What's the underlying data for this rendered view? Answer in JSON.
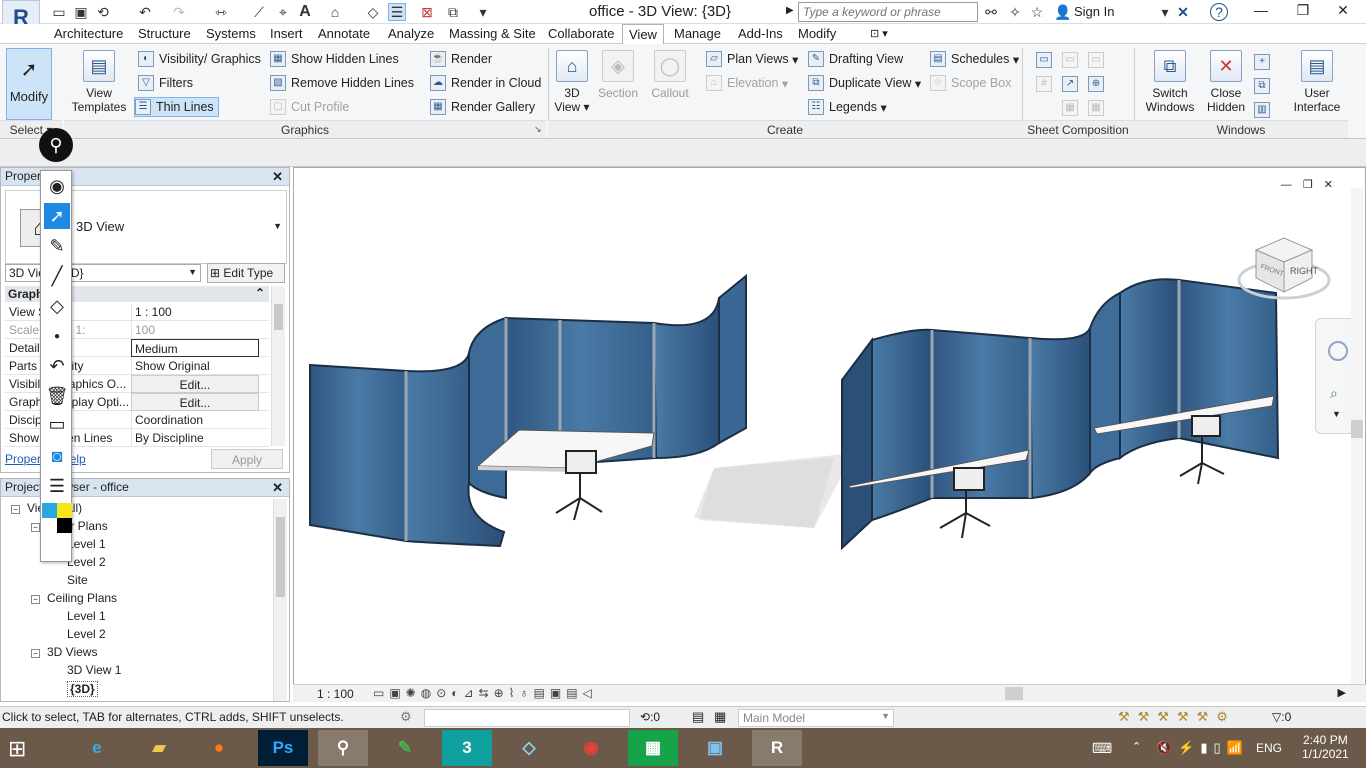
{
  "app": {
    "logo_letter": "R",
    "title": "office - 3D View: {3D}",
    "search_placeholder": "Type a keyword or phrase",
    "sign_in": "Sign In"
  },
  "ribbon_tabs": [
    "Architecture",
    "Structure",
    "Systems",
    "Insert",
    "Annotate",
    "Analyze",
    "Massing & Site",
    "Collaborate",
    "View",
    "Manage",
    "Add-Ins",
    "Modify"
  ],
  "active_tab": "View",
  "ribbon": {
    "modify": "Modify",
    "select": "Select",
    "view_templates": "View Templates",
    "visibility_graphics": "Visibility/ Graphics",
    "filters": "Filters",
    "thin_lines": "Thin Lines",
    "show_hidden_lines": "Show  Hidden Lines",
    "remove_hidden_lines": "Remove  Hidden Lines",
    "cut_profile": "Cut  Profile",
    "render": "Render",
    "render_in_cloud": "Render  in Cloud",
    "render_gallery": "Render  Gallery",
    "view_3d": "3D View",
    "section": "Section",
    "callout": "Callout",
    "plan_views": "Plan  Views",
    "elevation": "Elevation",
    "drafting_view": "Drafting  View",
    "duplicate_view": "Duplicate  View",
    "legends": "Legends",
    "schedules": "Schedules",
    "scope_box": "Scope  Box",
    "switch_windows": "Switch Windows",
    "close_hidden": "Close Hidden",
    "user_interface": "User Interface",
    "panels": {
      "graphics": "Graphics",
      "create": "Create",
      "sheet_composition": "Sheet Composition",
      "windows": "Windows"
    }
  },
  "properties": {
    "title": "Properties",
    "type_name": "3D View",
    "selector": "3D View: {3D}",
    "edit_type": "Edit Type",
    "section": "Graphics",
    "rows": [
      {
        "key": "View Scale",
        "value": "1 : 100",
        "disabled": false
      },
      {
        "key": "Scale Value    1:",
        "value": "100",
        "disabled": true
      },
      {
        "key": "Detail Level",
        "value": "Medium",
        "disabled": false
      },
      {
        "key": "Parts Visibility",
        "value": "Show Original",
        "disabled": false
      },
      {
        "key": "Visibility/Graphics O...",
        "value": "Edit...",
        "disabled": false
      },
      {
        "key": "Graphic Display Opti...",
        "value": "Edit...",
        "disabled": false
      },
      {
        "key": "Discipline",
        "value": "Coordination",
        "disabled": false
      },
      {
        "key": "Show Hidden Lines",
        "value": "By Discipline",
        "disabled": false
      }
    ],
    "help_link": "Properties help",
    "apply": "Apply"
  },
  "browser": {
    "title": "Project Browser - office",
    "items": [
      {
        "label": "Views (all)",
        "level": 0,
        "toggle": "-"
      },
      {
        "label": "Floor Plans",
        "level": 1,
        "toggle": "-"
      },
      {
        "label": "Level 1",
        "level": 2,
        "toggle": ""
      },
      {
        "label": "Level 2",
        "level": 2,
        "toggle": ""
      },
      {
        "label": "Site",
        "level": 2,
        "toggle": ""
      },
      {
        "label": "Ceiling Plans",
        "level": 1,
        "toggle": "-"
      },
      {
        "label": "Level 1",
        "level": 2,
        "toggle": ""
      },
      {
        "label": "Level 2",
        "level": 2,
        "toggle": ""
      },
      {
        "label": "3D Views",
        "level": 1,
        "toggle": "-"
      },
      {
        "label": "3D View 1",
        "level": 2,
        "toggle": ""
      },
      {
        "label": "{3D}",
        "level": 2,
        "toggle": "",
        "bold": true
      }
    ]
  },
  "viewcube": {
    "face_right": "RIGHT",
    "face_front": "FRONT"
  },
  "view_control": {
    "scale": "1 : 100"
  },
  "status": {
    "message": "Click to select, TAB for alternates, CTRL adds, SHIFT unselects.",
    "count": ":0",
    "workset": "Main Model",
    "filter_count": ":0"
  },
  "taskbar": {
    "apps": [
      "Internet Explorer",
      "File Explorer",
      "Firefox",
      "Photoshop",
      "Screen Annotation",
      "Whiteboard",
      "3ds Max",
      "Paint",
      "Chrome",
      "Calculator",
      "Photos",
      "Revit"
    ],
    "lang": "ENG",
    "time": "2:40 PM",
    "date": "1/1/2021"
  },
  "colors": {
    "panel_blue": "#3e6a94",
    "panel_blue_dark": "#2c4f72",
    "accent_blue": "#cde3f7",
    "desk": "#f4f4f4"
  }
}
